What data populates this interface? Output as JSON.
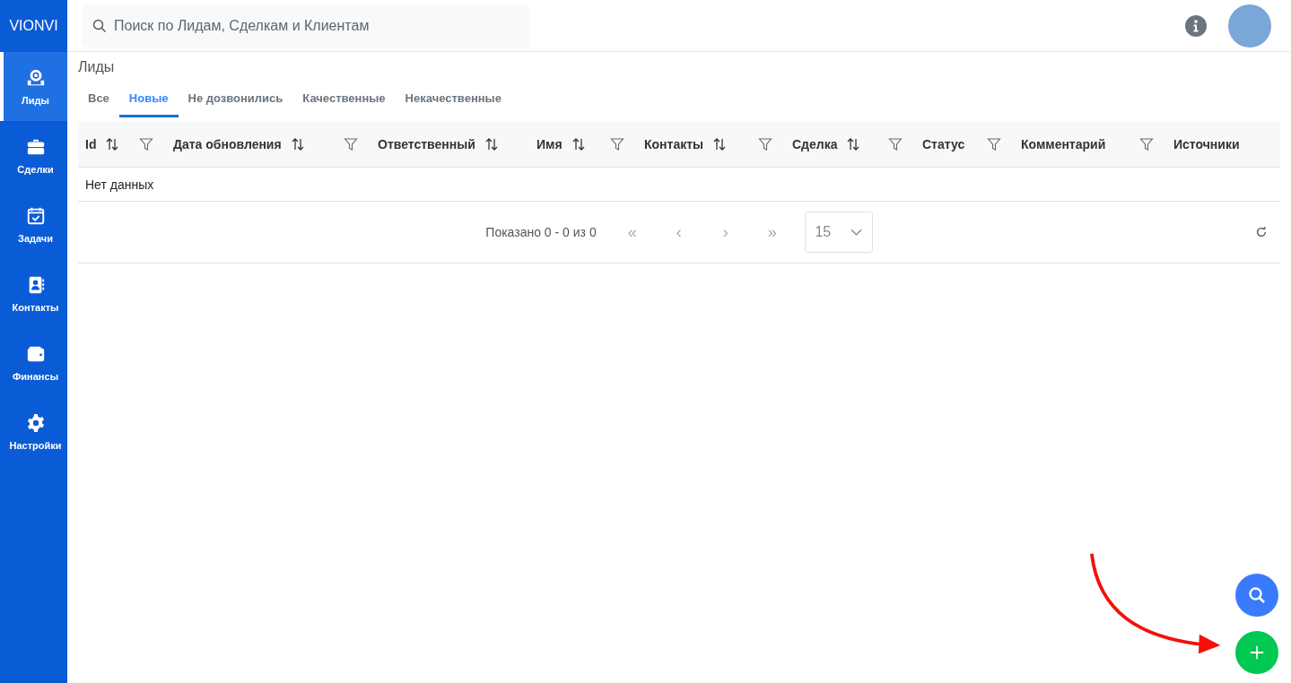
{
  "brand": "VIONVI",
  "sidebar": {
    "items": [
      {
        "label": "Лиды",
        "selected": true
      },
      {
        "label": "Сделки",
        "selected": false
      },
      {
        "label": "Задачи",
        "selected": false
      },
      {
        "label": "Контакты",
        "selected": false
      },
      {
        "label": "Финансы",
        "selected": false
      },
      {
        "label": "Настройки",
        "selected": false
      }
    ]
  },
  "search": {
    "placeholder": "Поиск по Лидам, Сделкам и Клиентам"
  },
  "page_title": "Лиды",
  "tabs": [
    {
      "label": "Все",
      "selected": false
    },
    {
      "label": "Новые",
      "selected": true
    },
    {
      "label": "Не дозвонились",
      "selected": false
    },
    {
      "label": "Качественные",
      "selected": false
    },
    {
      "label": "Некачественные",
      "selected": false
    }
  ],
  "table": {
    "columns": [
      {
        "label": "Id",
        "sortable": true,
        "filterable": true
      },
      {
        "label": "Дата обновления",
        "sortable": true,
        "filterable": true
      },
      {
        "label": "Ответственный",
        "sortable": true,
        "filterable": false
      },
      {
        "label": "Имя",
        "sortable": true,
        "filterable": true
      },
      {
        "label": "Контакты",
        "sortable": true,
        "filterable": true
      },
      {
        "label": "Сделка",
        "sortable": true,
        "filterable": true
      },
      {
        "label": "Статус",
        "sortable": false,
        "filterable": true
      },
      {
        "label": "Комментарий",
        "sortable": false,
        "filterable": true
      },
      {
        "label": "Источники",
        "sortable": false,
        "filterable": false
      }
    ],
    "empty_text": "Нет данных"
  },
  "pagination": {
    "summary": "Показано 0 - 0 из 0",
    "first": "«",
    "prev": "‹",
    "next": "›",
    "last": "»",
    "page_size": "15"
  }
}
